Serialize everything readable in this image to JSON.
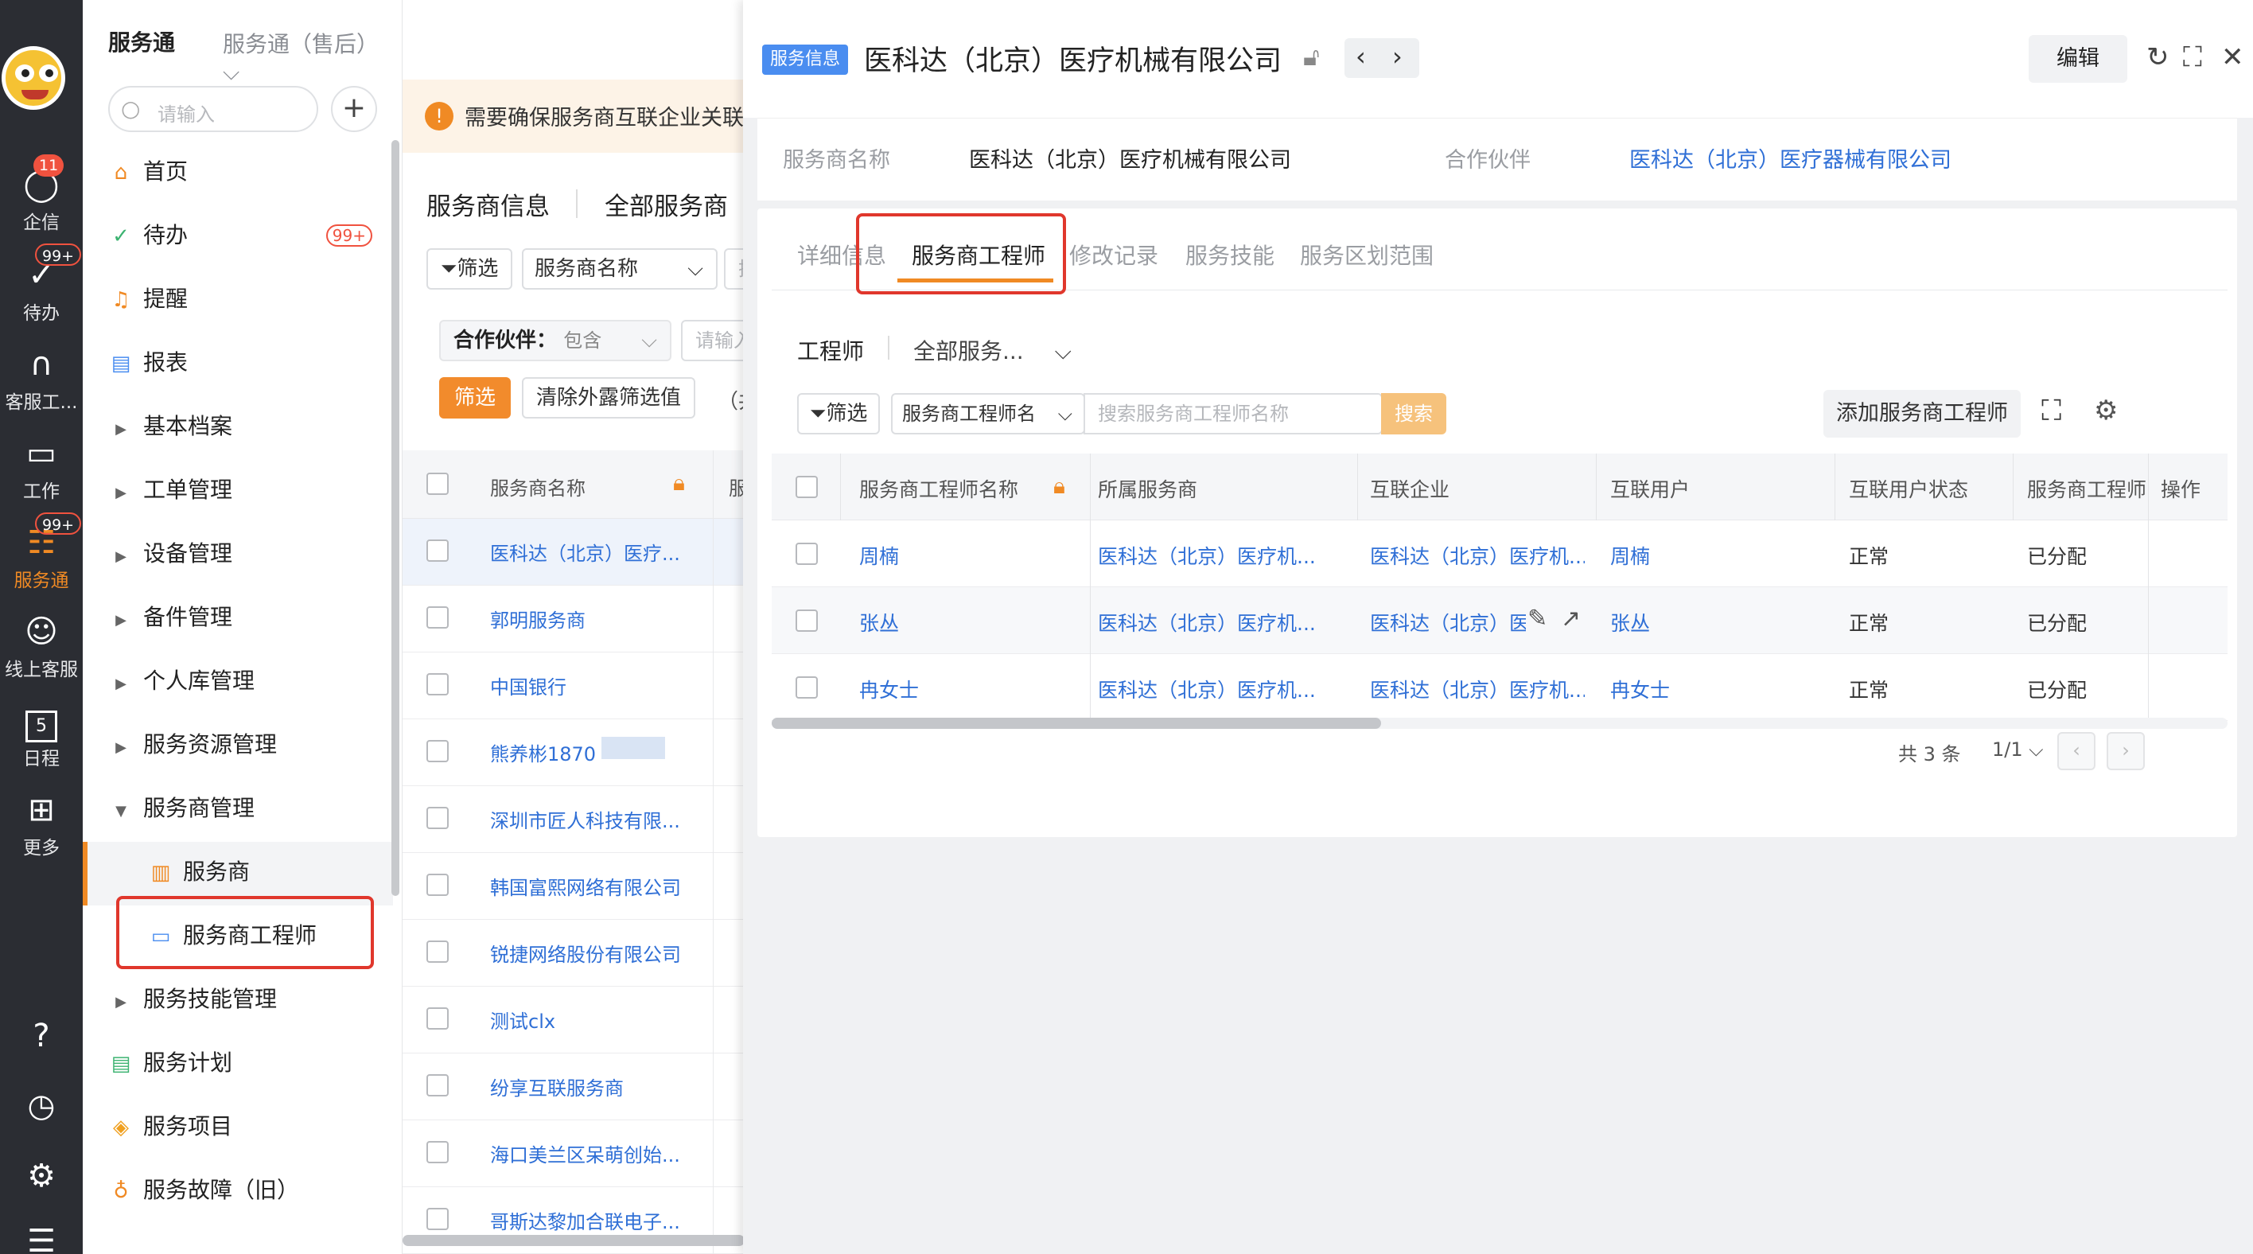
{
  "rail": {
    "items": [
      {
        "label": "企信",
        "badge": "11"
      },
      {
        "label": "待办",
        "badge": "99+"
      },
      {
        "label": "客服工..."
      },
      {
        "label": "工作"
      },
      {
        "label": "服务通",
        "badge": "99+"
      },
      {
        "label": "线上客服"
      },
      {
        "label": "日程",
        "day": "5"
      },
      {
        "label": "更多"
      }
    ]
  },
  "nav": {
    "app_name": "服务通",
    "app_switch": "服务通（售后）",
    "search_placeholder": "请输入",
    "todo_count": "99+",
    "items": [
      "首页",
      "待办",
      "提醒",
      "报表",
      "基本档案",
      "工单管理",
      "设备管理",
      "备件管理",
      "个人库管理",
      "服务资源管理",
      "服务商管理",
      "服务商",
      "服务商工程师",
      "服务技能管理",
      "服务计划",
      "服务项目",
      "服务故障（旧）"
    ]
  },
  "list": {
    "warning": "需要确保服务商互联企业关联",
    "tabs": [
      "服务商信息",
      "全部服务商"
    ],
    "filter_btn": "筛选",
    "field_select": "服务商名称",
    "search_stub": "搜",
    "partner_label": "合作伙伴：",
    "partner_op": "包含",
    "partner_placeholder": "请输入",
    "apply_btn": "筛选",
    "clear_btn": "清除外露筛选值",
    "paren": "（共",
    "col_name": "服务商名称",
    "col_next": "服",
    "rows": [
      "医科达（北京）医疗...",
      "郭明服务商",
      "中国银行",
      "熊养彬1870",
      "深圳市匠人科技有限...",
      "韩国富熙网络有限公司",
      "锐捷网络股份有限公司",
      "测试clx",
      "纷享互联服务商",
      "海口美兰区呆萌创始...",
      "哥斯达黎加合联电子..."
    ]
  },
  "panel": {
    "tag": "服务信息",
    "title": "医科达（北京）医疗机械有限公司",
    "edit_btn": "编辑",
    "summary": {
      "name_label": "服务商名称",
      "name_value": "医科达（北京）医疗机械有限公司",
      "partner_label": "合作伙伴",
      "partner_value": "医科达（北京）医疗器械有限公司"
    },
    "tabs": [
      "详细信息",
      "服务商工程师",
      "修改记录",
      "服务技能",
      "服务区划范围"
    ],
    "scope_label": "工程师",
    "scope_value": "全部服务...",
    "filter_btn": "筛选",
    "field_select": "服务商工程师名",
    "search_placeholder": "搜索服务商工程师名称",
    "search_btn": "搜索",
    "add_btn": "添加服务商工程师",
    "columns": [
      "服务商工程师名称",
      "所属服务商",
      "互联企业",
      "互联用户",
      "互联用户状态",
      "服务商工程师...",
      "操作"
    ],
    "rows": [
      {
        "name": "周楠",
        "provider": "医科达（北京）医疗机...",
        "enterprise": "医科达（北京）医疗机...",
        "user": "周楠",
        "status": "正常",
        "assign": "已分配"
      },
      {
        "name": "张丛",
        "provider": "医科达（北京）医疗机...",
        "enterprise": "医科达（北京）医疗",
        "user": "张丛",
        "status": "正常",
        "assign": "已分配"
      },
      {
        "name": "冉女士",
        "provider": "医科达（北京）医疗机...",
        "enterprise": "医科达（北京）医疗机...",
        "user": "冉女士",
        "status": "正常",
        "assign": "已分配"
      }
    ],
    "total": "共 3 条",
    "page": "1/1"
  },
  "colors": {
    "accent": "#f08a24",
    "link": "#2f6fd6",
    "badge": "#f0523f",
    "tag": "#4a8df0",
    "highlight": "#e0372c"
  }
}
